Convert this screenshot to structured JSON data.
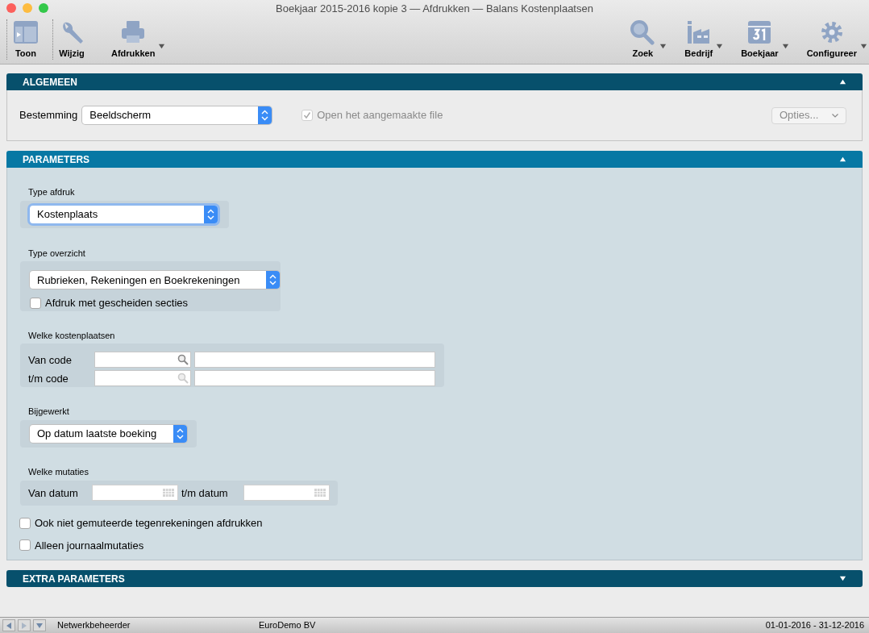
{
  "window": {
    "title": "Boekjaar 2015-2016 kopie 3 — Afdrukken — Balans Kostenplaatsen"
  },
  "toolbar": {
    "left": [
      {
        "label": "Toon",
        "kind": "layout",
        "menu": false
      },
      {
        "label": "Wijzig",
        "kind": "wrench",
        "menu": false
      },
      {
        "label": "Afdrukken",
        "kind": "printer",
        "menu": true
      }
    ],
    "right": [
      {
        "label": "Zoek",
        "kind": "search",
        "menu": true
      },
      {
        "label": "Bedrijf",
        "kind": "factory",
        "menu": true
      },
      {
        "label": "Boekjaar",
        "kind": "calendar",
        "menu": true
      },
      {
        "label": "Configureer",
        "kind": "gear",
        "menu": true
      }
    ]
  },
  "algemeen": {
    "title": "ALGEMEEN",
    "expanded": true,
    "destination_label": "Bestemming",
    "destination_value": "Beeldscherm",
    "open_file": {
      "label": "Open het aangemaakte file",
      "checked": true,
      "disabled": true
    },
    "options_button": "Opties..."
  },
  "parameters": {
    "title": "PARAMETERS",
    "expanded": true,
    "type_afdruk": {
      "label": "Type afdruk",
      "value": "Kostenplaats"
    },
    "type_overzicht": {
      "label": "Type overzicht",
      "value": "Rubrieken, Rekeningen en Boekrekeningen",
      "separate": {
        "label": "Afdruk met gescheiden secties",
        "checked": false
      }
    },
    "kostenplaatsen": {
      "label": "Welke kostenplaatsen",
      "rows": [
        {
          "label": "Van code",
          "disabled": false
        },
        {
          "label": "t/m code",
          "disabled": true
        }
      ]
    },
    "bijgewerkt": {
      "label": "Bijgewerkt",
      "value": "Op datum laatste boeking"
    },
    "mutaties": {
      "label": "Welke mutaties",
      "from_label": "Van datum",
      "to_label": "t/m datum"
    },
    "checkboxes": [
      {
        "label": "Ook niet gemuteerde tegenrekeningen afdrukken",
        "checked": false
      },
      {
        "label": "Alleen journaalmutaties",
        "checked": false
      }
    ]
  },
  "extra_parameters": {
    "title": "EXTRA PARAMETERS",
    "expanded": false
  },
  "status_bar": {
    "user": "Netwerkbeheerder",
    "company": "EuroDemo BV",
    "period": "01-01-2016 - 31-12-2016"
  }
}
